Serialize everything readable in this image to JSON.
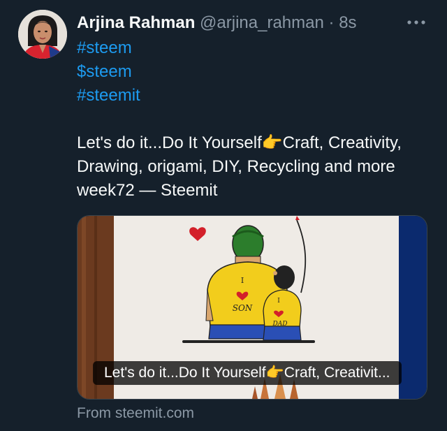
{
  "author": {
    "name": "Arjina Rahman",
    "handle": "@arjina_rahman",
    "separator": "·",
    "time": "8s"
  },
  "more_icon": "more-horizontal-icon",
  "tweet": {
    "tags": [
      "#steem",
      "$steem",
      "#steemit"
    ],
    "body_lines": [
      "Let's do it...Do It Yourself👉Craft, Creativity,",
      "Drawing, origami, DIY, Recycling and more",
      "week72 — Steemit"
    ]
  },
  "card": {
    "title": "Let's do it...Do It Yourself👉Craft, Creativit...",
    "drawing_text": {
      "dad_shirt_i": "I",
      "dad_shirt_word": "SON",
      "son_shirt_i": "I",
      "son_shirt_word": "DAD"
    }
  },
  "source": "From steemit.com",
  "colors": {
    "background": "#15202b",
    "link": "#1d9bf0",
    "secondary_text": "#8b98a5",
    "primary_text": "#f7f9f9"
  }
}
